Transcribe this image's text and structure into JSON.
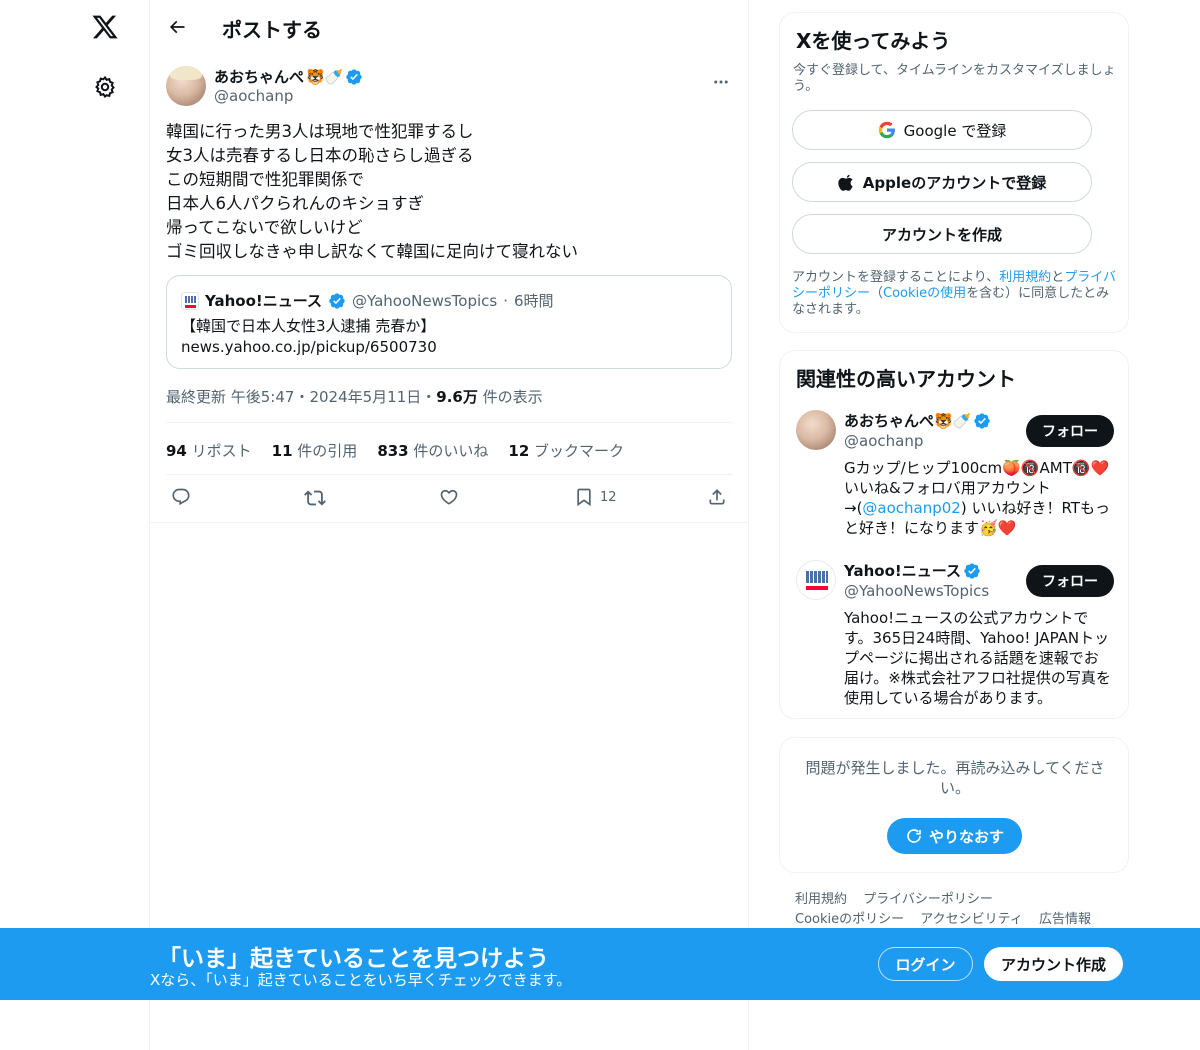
{
  "colors": {
    "accent": "#1d9bf0",
    "text": "#0f1419",
    "muted": "#536471",
    "border": "#eff3f4",
    "verified": "#1d9bf0"
  },
  "nav": {
    "logo_icon": "x-logo-icon",
    "settings_icon": "gear-icon"
  },
  "header": {
    "title": "ポストする",
    "back_icon": "arrow-left-icon"
  },
  "post": {
    "author": {
      "name": "あおちゃんぺ",
      "name_emoji": "🐯🍼",
      "handle": "@aochanp"
    },
    "text": "韓国に行った男3人は現地で性犯罪するし\n女3人は売春するし日本の恥さらし過ぎる\nこの短期間で性犯罪関係で\n日本人6人パクられんのキショすぎ\n帰ってこないで欲しいけど\nゴミ回収しなきゃ申し訳なくて韓国に足向けて寝れない",
    "quote": {
      "name": "Yahoo!ニュース",
      "handle": "@YahooNewsTopics",
      "dot": "·",
      "time": "6時間",
      "line1": "【韓国で日本人女性3人逮捕 売春か】",
      "line2": "news.yahoo.co.jp/pickup/6500730"
    },
    "meta": {
      "prefix": "最終更新 午後5:47・2024年5月11日・",
      "views": "9.6万",
      "views_label": " 件の表示"
    },
    "stats": [
      {
        "num": "94",
        "label": " リポスト"
      },
      {
        "num": "11",
        "label": " 件の引用"
      },
      {
        "num": "833",
        "label": " 件のいいね"
      },
      {
        "num": "12",
        "label": " ブックマーク"
      }
    ],
    "actions": {
      "bookmark_count": "12"
    }
  },
  "signup_card": {
    "title": "Xを使ってみよう",
    "subtitle": "今すぐ登録して、タイムラインをカスタマイズしましょう。",
    "google_label": "Google で登録",
    "apple_label": "Appleのアカウントで登録",
    "create_label": "アカウントを作成",
    "legal_1": "アカウントを登録することにより、",
    "legal_terms": "利用規約",
    "legal_2": "と",
    "legal_privacy": "プライバシーポリシー",
    "legal_3": "（",
    "legal_cookie": "Cookieの使用",
    "legal_4": "を含む）に同意したとみなされます。"
  },
  "relevant": {
    "title": "関連性の高いアカウント",
    "follow_label": "フォロー",
    "accounts": [
      {
        "name": "あおちゃんぺ🐯🍼",
        "handle": "@aochanp",
        "bio_1": "Gカップ/ヒップ100cm🍑🔞AMT🔞❤️いいね&フォロバ用アカウント→(",
        "bio_link": "@aochanp02",
        "bio_2": ") いいね好き！RTもっと好き！になります🥳❤️"
      },
      {
        "name": "Yahoo!ニュース",
        "handle": "@YahooNewsTopics",
        "bio": "Yahoo!ニュースの公式アカウントです。365日24時間、Yahoo! JAPANトップページに掲出される話題を速報でお届け。※株式会社アフロ社提供の写真を使用している場合があります。"
      }
    ]
  },
  "error_card": {
    "message": "問題が発生しました。再読み込みしてください。",
    "retry_label": "やりなおす"
  },
  "footer": {
    "links": [
      "利用規約",
      "プライバシーポリシー",
      "Cookieのポリシー",
      "アクセシビリティ",
      "広告情報"
    ]
  },
  "bottom_bar": {
    "title": "「いま」起きていることを見つけよう",
    "subtitle": "Xなら、「いま」起きていることをいち早くチェックできます。",
    "login_label": "ログイン",
    "signup_label": "アカウント作成"
  }
}
